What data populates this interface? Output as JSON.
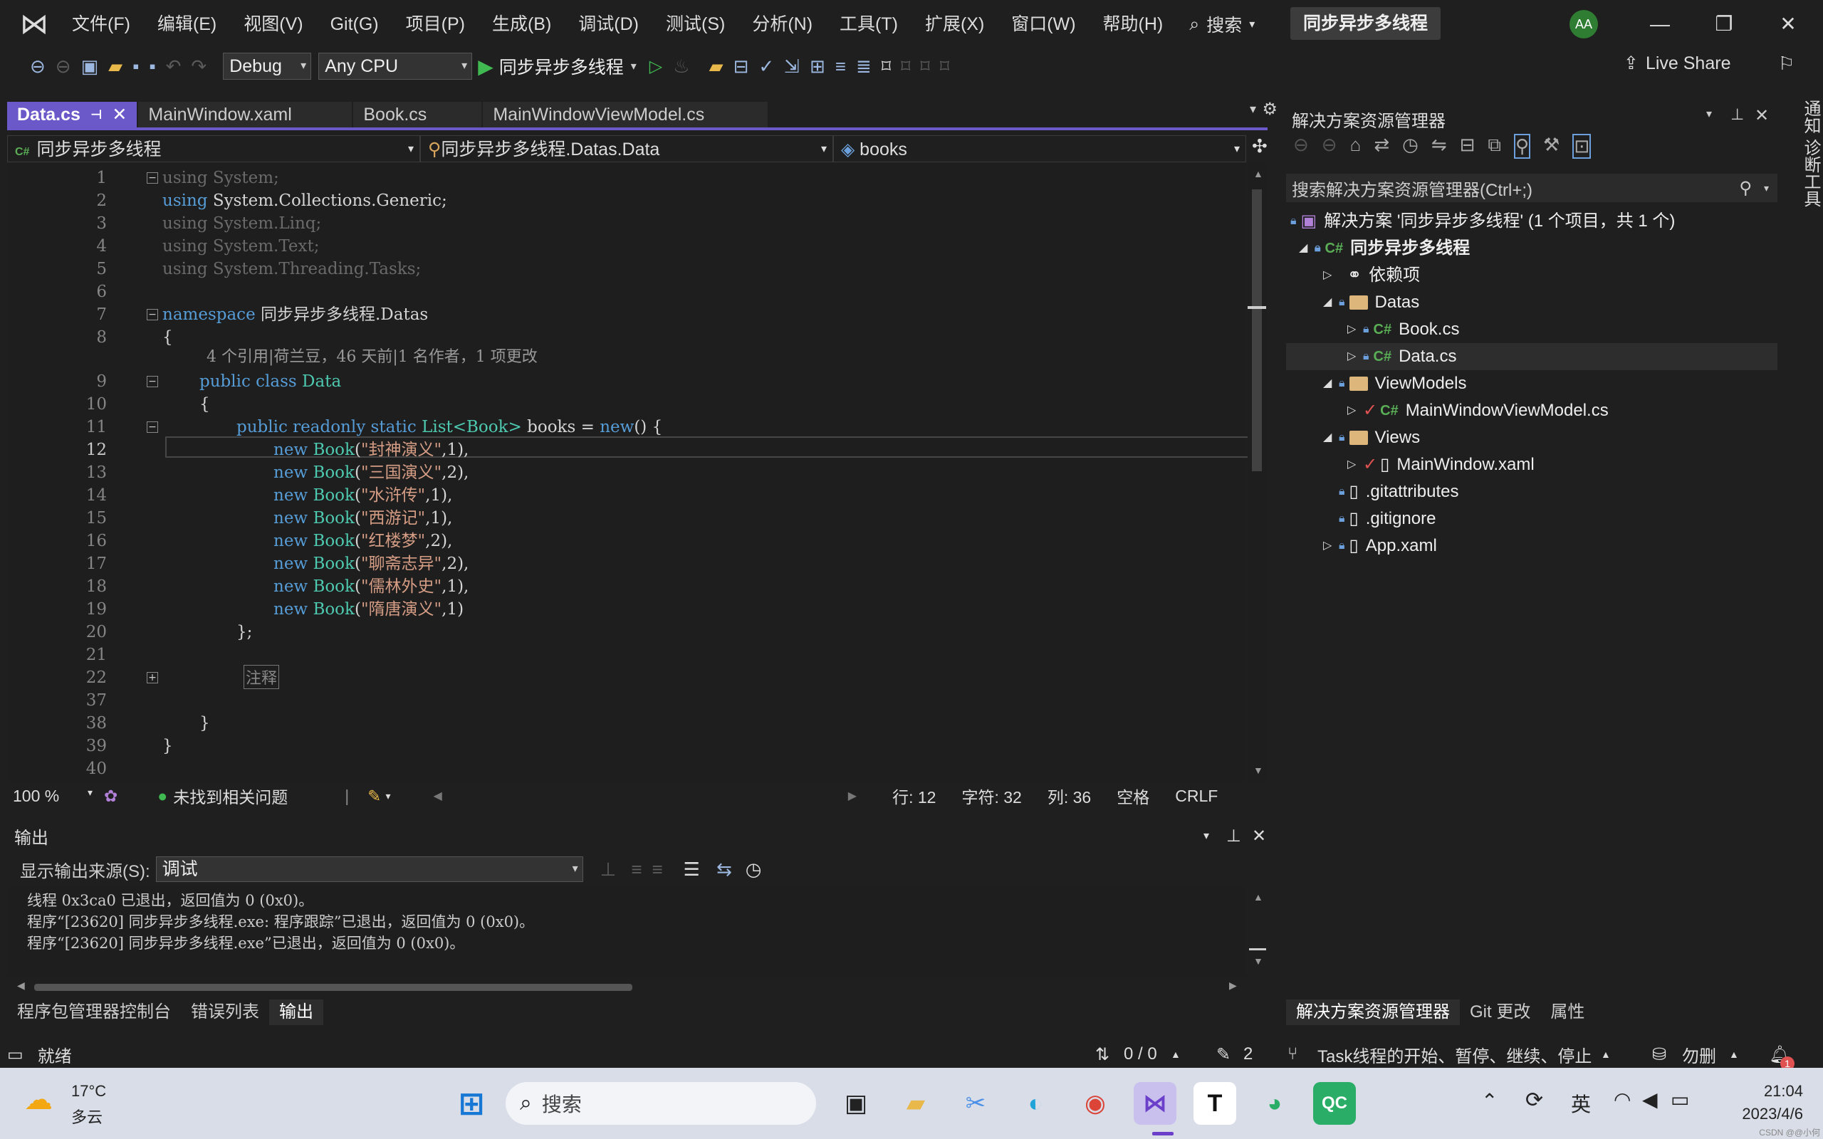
{
  "app": {
    "menu": [
      "文件(F)",
      "编辑(E)",
      "视图(V)",
      "Git(G)",
      "项目(P)",
      "生成(B)",
      "调试(D)",
      "测试(S)",
      "分析(N)",
      "工具(T)",
      "扩展(X)",
      "窗口(W)",
      "帮助(H)"
    ],
    "search": "搜索",
    "solution_badge": "同步异步多线程",
    "avatar": "AA"
  },
  "toolbar": {
    "config": "Debug",
    "platform": "Any CPU",
    "run_target": "同步异步多线程",
    "live_share": "Live Share"
  },
  "tabs": [
    "Data.cs",
    "MainWindow.xaml",
    "Book.cs",
    "MainWindowViewModel.cs"
  ],
  "nav": {
    "project": "同步异步多线程",
    "type": "同步异步多线程.Datas.Data",
    "member": "books"
  },
  "editor": {
    "line_numbers": [
      "1",
      "2",
      "3",
      "4",
      "5",
      "6",
      "7",
      "8",
      "9",
      "10",
      "11",
      "12",
      "13",
      "14",
      "15",
      "16",
      "17",
      "18",
      "19",
      "20",
      "21",
      "22",
      "37",
      "38",
      "39",
      "40"
    ],
    "codelens": "4 个引用|荷兰豆，46 天前|1 名作者，1 项更改",
    "lines": {
      "l1": "using System;",
      "l2": "using System.Collections.Generic;",
      "l3": "using System.Linq;",
      "l4": "using System.Text;",
      "l5": "using System.Threading.Tasks;",
      "l7a": "namespace",
      "l7b": " 同步异步多线程.Datas",
      "l8": "{",
      "l9a": "public class",
      "l9b": " Data",
      "l10": "{",
      "l11a": "public readonly static",
      "l11b": " List<Book>",
      "l11c": " books = ",
      "l11d": "new",
      "l11e": "() {",
      "b": [
        {
          "n": "new",
          " t": "",
          "c": "Book",
          "s": "\"封神演义\"",
          "v": ",1),"
        },
        {
          "n": "new",
          "c": "Book",
          "s": "\"三国演义\"",
          "v": ",2),"
        },
        {
          "n": "new",
          "c": "Book",
          "s": "\"水浒传\"",
          "v": ",1),"
        },
        {
          "n": "new",
          "c": "Book",
          "s": "\"西游记\"",
          "v": ",1),"
        },
        {
          "n": "new",
          "c": "Book",
          "s": "\"红楼梦\"",
          "v": ",2),"
        },
        {
          "n": "new",
          "c": "Book",
          "s": "\"聊斋志异\"",
          "v": ",2),"
        },
        {
          "n": "new",
          "c": "Book",
          "s": "\"儒林外史\"",
          "v": ",1),"
        },
        {
          "n": "new",
          "c": "Book",
          "s": "\"隋唐演义\"",
          "v": ",1)"
        }
      ],
      "l20": "};",
      "l22": "注释",
      "l38": "}",
      "l39": "}"
    }
  },
  "editor_status": {
    "zoom": "100 %",
    "issues": "未找到相关问题",
    "line": "行: 12",
    "char": "字符: 32",
    "col": "列: 36",
    "spaces": "空格",
    "eol": "CRLF"
  },
  "output": {
    "title": "输出",
    "source_label": "显示输出来源(S):",
    "source_value": "调试",
    "text": "线程 0x3ca0 已退出，返回值为 0 (0x0)。\n程序“[23620] 同步异步多线程.exe: 程序跟踪”已退出，返回值为 0 (0x0)。\n程序“[23620] 同步异步多线程.exe”已退出，返回值为 0 (0x0)。"
  },
  "bottom_tabs": [
    "程序包管理器控制台",
    "错误列表",
    "输出"
  ],
  "solution_explorer": {
    "title": "解决方案资源管理器",
    "search": "搜索解决方案资源管理器(Ctrl+;)",
    "solution": "解决方案 '同步异步多线程' (1 个项目，共 1 个)",
    "project": "同步异步多线程",
    "deps": "依赖项",
    "datas": "Datas",
    "book": "Book.cs",
    "data": "Data.cs",
    "viewmodels": "ViewModels",
    "mwvm": "MainWindowViewModel.cs",
    "views": "Views",
    "mwx": "MainWindow.xaml",
    "gitattr": ".gitattributes",
    "gitignore": ".gitignore",
    "appx": "App.xaml"
  },
  "se_tabs": [
    "解决方案资源管理器",
    "Git 更改",
    "属性"
  ],
  "right_rail": "通知 诊断工具",
  "status": {
    "ready": "就绪",
    "updown": "0 / 0",
    "pencil": "2",
    "branch": "Task线程的开始、暂停、继续、停止",
    "repo": "勿删"
  },
  "taskbar": {
    "temp": "17°C",
    "weather": "多云",
    "search": "搜索",
    "ime": "英",
    "time": "21:04",
    "date": "2023/4/6",
    "watermark": "CSDN @@小何"
  }
}
